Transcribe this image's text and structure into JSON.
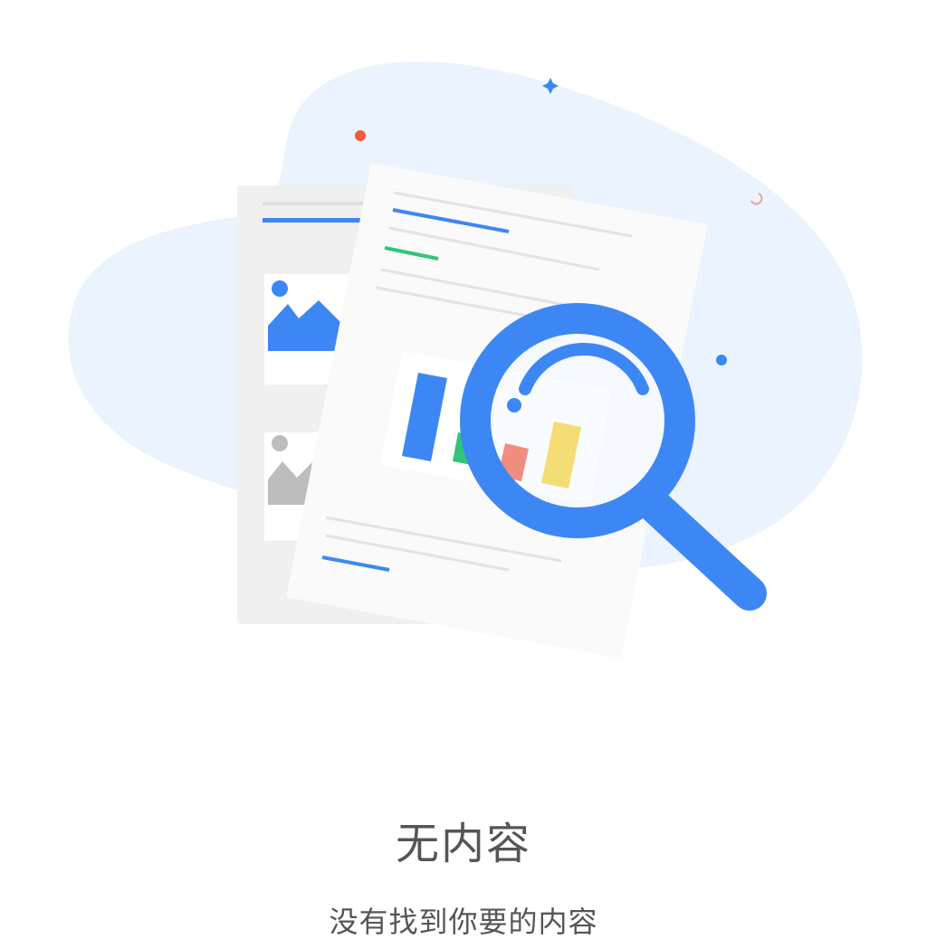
{
  "empty_state": {
    "title": "无内容",
    "subtitle": "没有找到你要的内容",
    "illustration_icon": "document-search-icon"
  },
  "colors": {
    "primary_blue": "#3d87f5",
    "blob_background": "#eaf3fe",
    "green": "#34c47c",
    "red": "#f4573b",
    "yellow": "#fbd22c",
    "gray": "#bdbdbd",
    "text": "#555555"
  }
}
